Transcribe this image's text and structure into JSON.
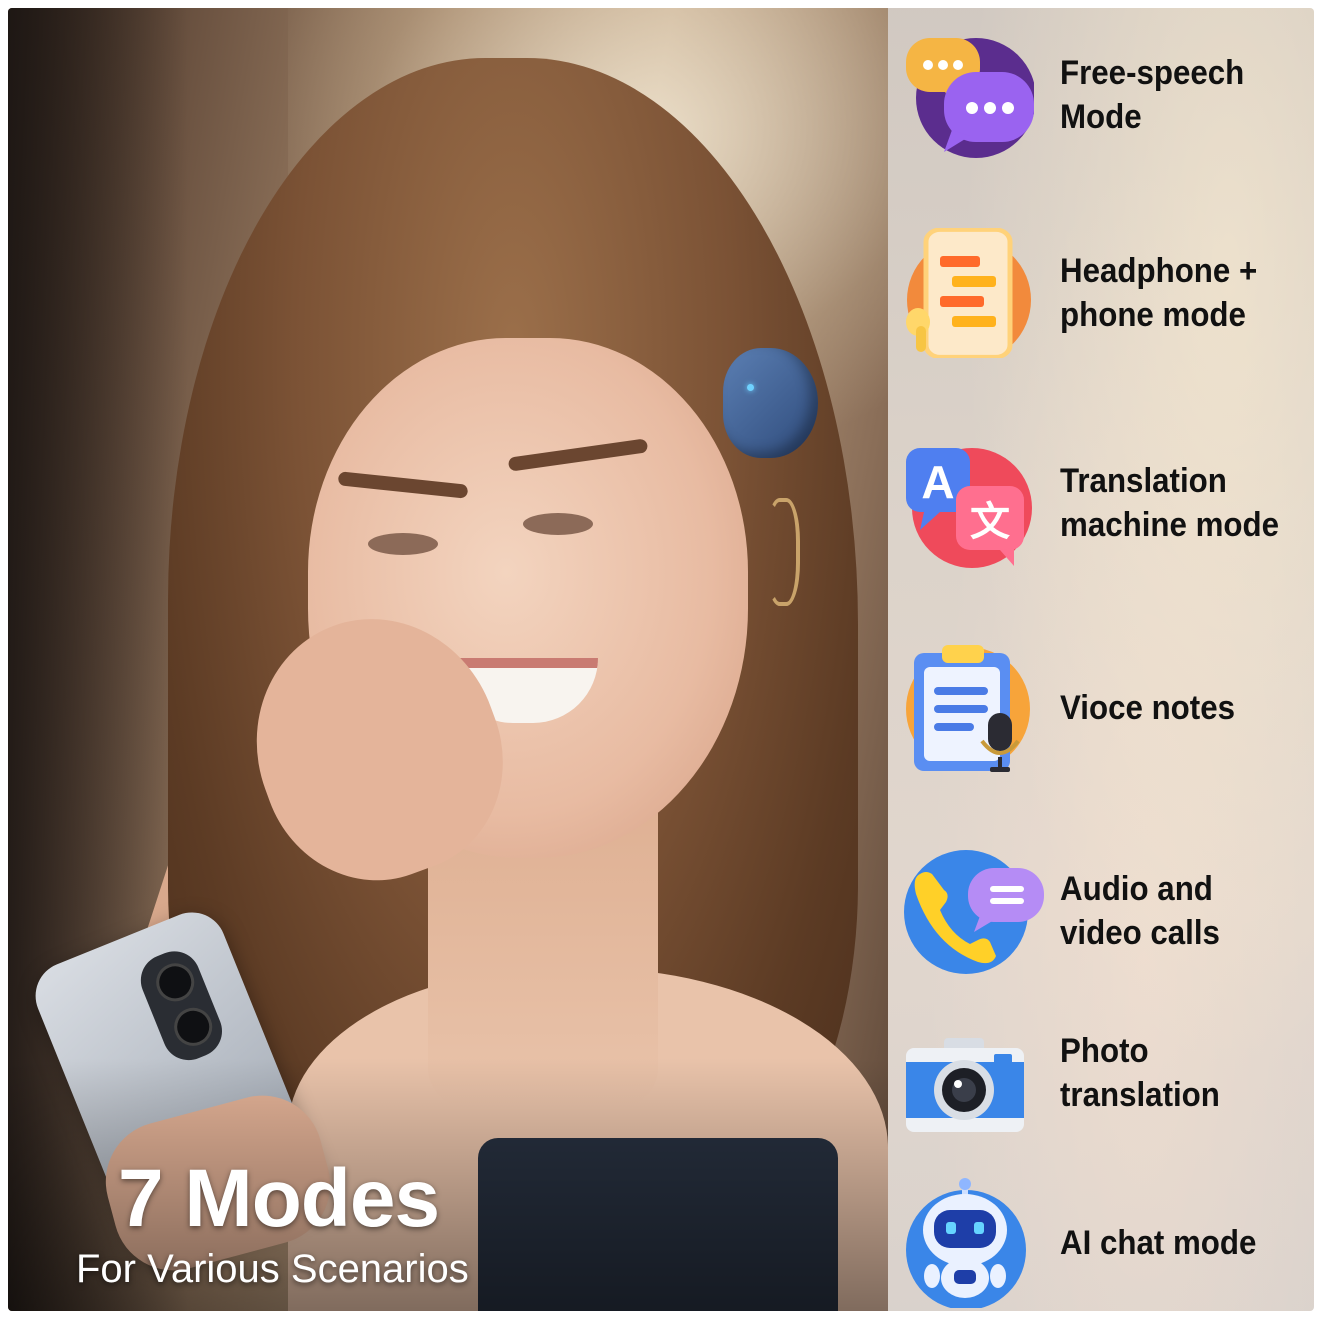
{
  "hero": {
    "headline": "7 Modes",
    "subheadline": "For Various Scenarios"
  },
  "modes": [
    {
      "label": "Free-speech Mode",
      "icon": "chat-bubbles-icon"
    },
    {
      "label": "Headphone + phone mode",
      "icon": "earbud-phone-icon"
    },
    {
      "label": "Translation machine mode",
      "icon": "translate-icon"
    },
    {
      "label": "Vioce notes",
      "icon": "clipboard-microphone-icon"
    },
    {
      "label": "Audio and video calls",
      "icon": "phone-call-icon"
    },
    {
      "label": "Photo translation",
      "icon": "camera-icon"
    },
    {
      "label": "AI chat mode",
      "icon": "robot-icon"
    }
  ],
  "colors": {
    "panel_text": "#111111",
    "hero_text": "#ffffff",
    "purple": "#7b4fd6",
    "orange": "#f28a3c",
    "red": "#ef4a5b",
    "blue": "#3a86e8"
  }
}
